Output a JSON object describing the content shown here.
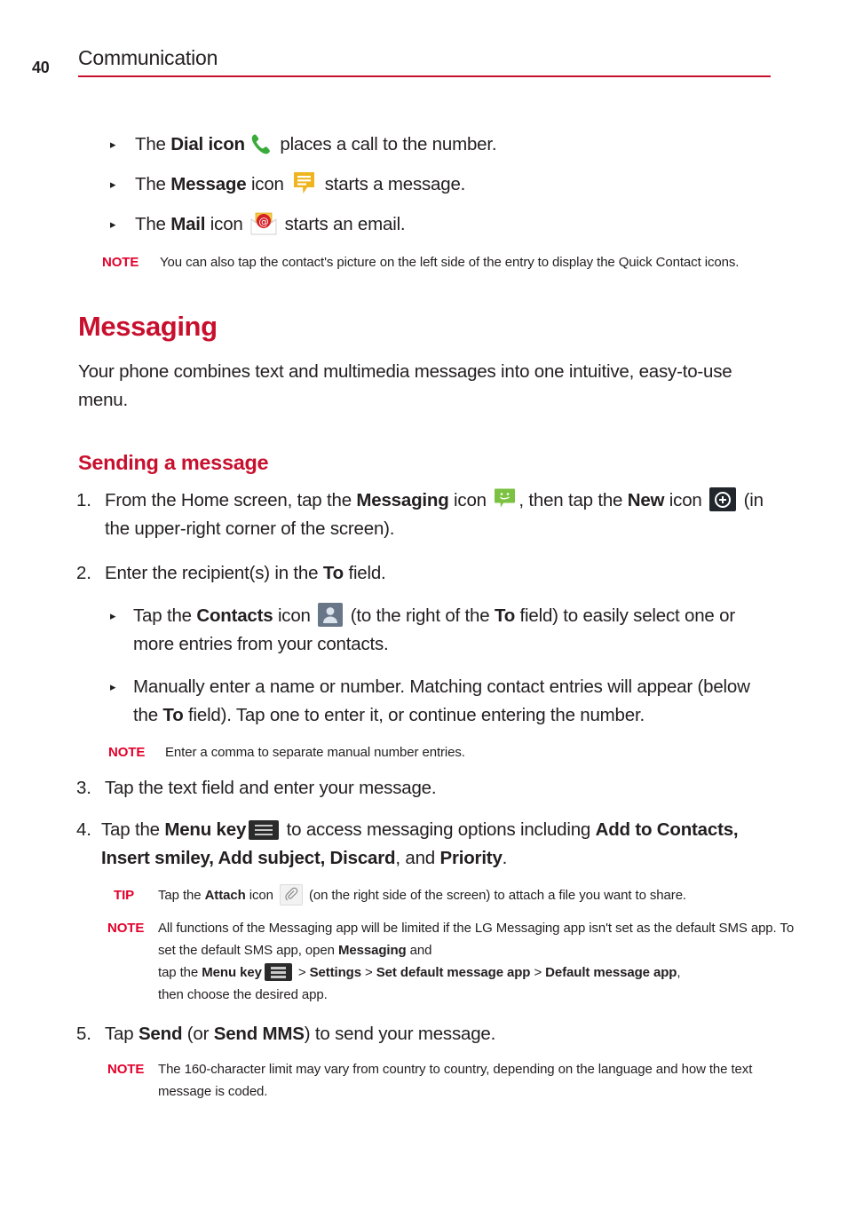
{
  "header": {
    "page_number": "40",
    "title": "Communication",
    "rule_color": "#c8102e"
  },
  "colors": {
    "accent_red": "#c8102e",
    "note_red": "#e3002b",
    "phone_green": "#3aaa3a",
    "bubble_yellow": "#efb51f",
    "messaging_green": "#7cc242",
    "contacts_gray": "#697687",
    "menukey_dark": "#2b2b2b",
    "mail_red": "#d62027"
  },
  "bullets": [
    {
      "pre": "The ",
      "bold": "Dial icon",
      "icon": "phone-icon",
      "post": " places a call to the number."
    },
    {
      "pre": "The ",
      "bold": "Message",
      "mid": " icon ",
      "icon": "message-bubble-icon",
      "post": " starts a message."
    },
    {
      "pre": "The ",
      "bold": "Mail",
      "mid": " icon ",
      "icon": "mail-icon",
      "post": " starts an email."
    }
  ],
  "note_quick_contact": {
    "label": "NOTE",
    "text": "You can also tap the contact's picture on the left side of the entry to display the Quick Contact icons."
  },
  "section": {
    "heading": "Messaging",
    "intro": "Your phone combines text and multimedia messages into one intuitive, easy-to-use menu.",
    "subheading": "Sending a message"
  },
  "steps": {
    "step1": {
      "num": "1.",
      "part1": "From the Home screen, tap the ",
      "bold1": "Messaging",
      "part2": " icon ",
      "icon1": "messaging-smiley-icon",
      "part3": ", then tap the ",
      "bold2": "New",
      "part4": " icon ",
      "icon2": "new-plus-icon",
      "part5": " (in the upper-right corner of the screen)."
    },
    "step2": {
      "num": "2.",
      "part1": "Enter the recipient(s) in the ",
      "bold1": "To",
      "part2": " field."
    },
    "step2_sub1": {
      "part1": "Tap the ",
      "bold1": "Contacts",
      "part2": " icon ",
      "icon1": "contacts-person-icon",
      "part3": " (to the right of the ",
      "bold2": "To",
      "part4": " field) to easily select one or more entries from your contacts."
    },
    "step2_sub2": {
      "part1": "Manually enter a name or number. Matching contact entries will appear (below the ",
      "bold1": "To",
      "part2": " field). Tap one to enter it, or continue entering the number."
    },
    "note_comma": {
      "label": "NOTE",
      "text": "Enter a comma to separate manual number entries."
    },
    "step3": {
      "num": "3.",
      "text": "Tap the text field and enter your message."
    },
    "step4": {
      "num": "4.",
      "part1": "Tap the ",
      "bold1": "Menu key",
      "icon1": "menu-key-icon",
      "part2": " to access messaging options including ",
      "bold2": "Add to Contacts, Insert smiley, Add subject, Discard",
      "part3": ", and ",
      "bold3": "Priority",
      "part4": "."
    },
    "tip_attach": {
      "label": "TIP",
      "part1": "Tap the ",
      "bold1": "Attach",
      "part2": " icon ",
      "icon1": "attach-paperclip-icon",
      "part3": " (on the right side of the screen) to attach a file you want to share."
    },
    "note_default_sms": {
      "label": "NOTE",
      "part1": "All functions of the Messaging app will be limited if the LG Messaging app isn't set as the default SMS app. To set the default SMS app, open ",
      "bold1": "Messaging",
      "part2": " and",
      "line3_part1": "tap the ",
      "bold2": "Menu key",
      "icon1": "menu-key-icon",
      "line3_part2": " > ",
      "bold3": "Settings",
      "line3_part3": " > ",
      "bold4": "Set default message app",
      "line3_part4": " > ",
      "bold5": "Default message app",
      "line3_part5": ",",
      "line4": "then choose the desired app."
    },
    "step5": {
      "num": "5.",
      "part1": "Tap ",
      "bold1": "Send",
      "part2": " (or ",
      "bold2": "Send MMS",
      "part3": ") to send your message."
    },
    "note_160": {
      "label": "NOTE",
      "text": "The 160-character limit may vary from country to country, depending on the language and how the text message is coded."
    }
  }
}
